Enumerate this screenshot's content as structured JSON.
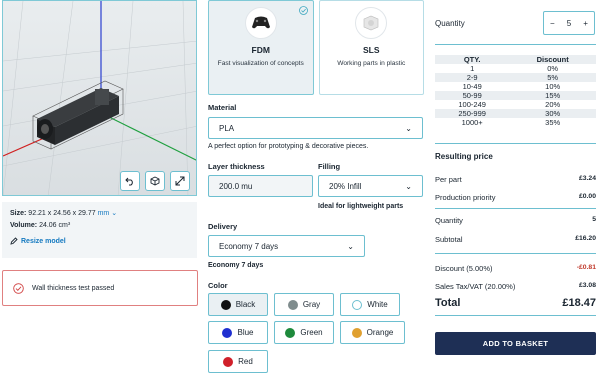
{
  "viewer": {
    "buttons": [
      {
        "name": "undo-icon"
      },
      {
        "name": "cube-icon"
      },
      {
        "name": "expand-icon"
      }
    ]
  },
  "model_info": {
    "size_label": "Size:",
    "size_value": "92.21 x 24.56 x 29.77",
    "size_unit": "mm",
    "volume_label": "Volume:",
    "volume_value": "24.06 cm³",
    "resize_label": "Resize model"
  },
  "wall_check": {
    "text": "Wall thickness test passed"
  },
  "technologies": [
    {
      "name": "FDM",
      "desc": "Fast visualization of concepts",
      "selected": true
    },
    {
      "name": "SLS",
      "desc": "Working parts in plastic",
      "selected": false
    }
  ],
  "material": {
    "label": "Material",
    "value": "PLA",
    "hint": "A perfect option for prototyping & decorative pieces."
  },
  "layer": {
    "label": "Layer thickness",
    "value": "200.0 mu"
  },
  "filling": {
    "label": "Filling",
    "value": "20% Infill",
    "hint": "Ideal for lightweight parts"
  },
  "delivery": {
    "label": "Delivery",
    "value": "Economy 7 days",
    "hint": "Economy 7 days"
  },
  "color": {
    "label": "Color",
    "options": [
      {
        "name": "Black",
        "hex": "#111111",
        "selected": true
      },
      {
        "name": "Gray",
        "hex": "#7f8c8d",
        "selected": false
      },
      {
        "name": "White",
        "hex": "#ffffff",
        "selected": false
      },
      {
        "name": "Blue",
        "hex": "#1f2fd0",
        "selected": false
      },
      {
        "name": "Green",
        "hex": "#1e8a3c",
        "selected": false
      },
      {
        "name": "Orange",
        "hex": "#e0a030",
        "selected": false
      },
      {
        "name": "Red",
        "hex": "#d0202a",
        "selected": false
      }
    ]
  },
  "quantity": {
    "label": "Quantity",
    "value": "5",
    "minus": "−",
    "plus": "+"
  },
  "discounts": {
    "headers": [
      "QTY.",
      "Discount"
    ],
    "rows": [
      [
        "1",
        "0%"
      ],
      [
        "2-9",
        "5%"
      ],
      [
        "10-49",
        "10%"
      ],
      [
        "50-99",
        "15%"
      ],
      [
        "100-249",
        "20%"
      ],
      [
        "250-999",
        "30%"
      ],
      [
        "1000+",
        "35%"
      ]
    ]
  },
  "price": {
    "title": "Resulting price",
    "per_part_label": "Per part",
    "per_part": "£3.24",
    "priority_label": "Production priority",
    "priority": "£0.00",
    "quantity_label": "Quantity",
    "quantity": "5",
    "subtotal_label": "Subtotal",
    "subtotal": "£16.20",
    "discount_label": "Discount (5.00%)",
    "discount": "-£0.81",
    "tax_label": "Sales Tax/VAT (20.00%)",
    "tax": "£3.08",
    "total_label": "Total",
    "total": "£18.47"
  },
  "basket": {
    "label": "ADD TO BASKET"
  },
  "colors": {
    "accent": "#6dbfd0",
    "brand_dark": "#1e2f55",
    "link": "#1479c0",
    "error_border": "#e08080"
  }
}
